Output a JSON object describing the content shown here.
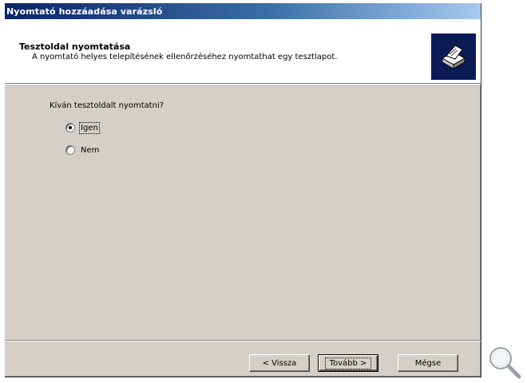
{
  "window": {
    "title": "Nyomtató hozzáadása varázsló"
  },
  "header": {
    "title": "Tesztoldal nyomtatása",
    "subtitle": "A nyomtató helyes telepítésének ellenőrzéséhez nyomtathat egy tesztlapot.",
    "icon": "printer-icon"
  },
  "content": {
    "question": "Kíván tesztoldalt nyomtatni?",
    "options": [
      {
        "label": "Igen",
        "checked": true
      },
      {
        "label": "Nem",
        "checked": false
      }
    ]
  },
  "buttons": {
    "back": "< Vissza",
    "next": "Tovább >",
    "cancel": "Mégse"
  },
  "overlay": {
    "icon": "magnifier-icon"
  },
  "colors": {
    "titlebar_start": "#0a246a",
    "titlebar_end": "#a6caf0",
    "dialog_bg": "#d4d0c8",
    "icon_bg": "#0a1a55"
  }
}
